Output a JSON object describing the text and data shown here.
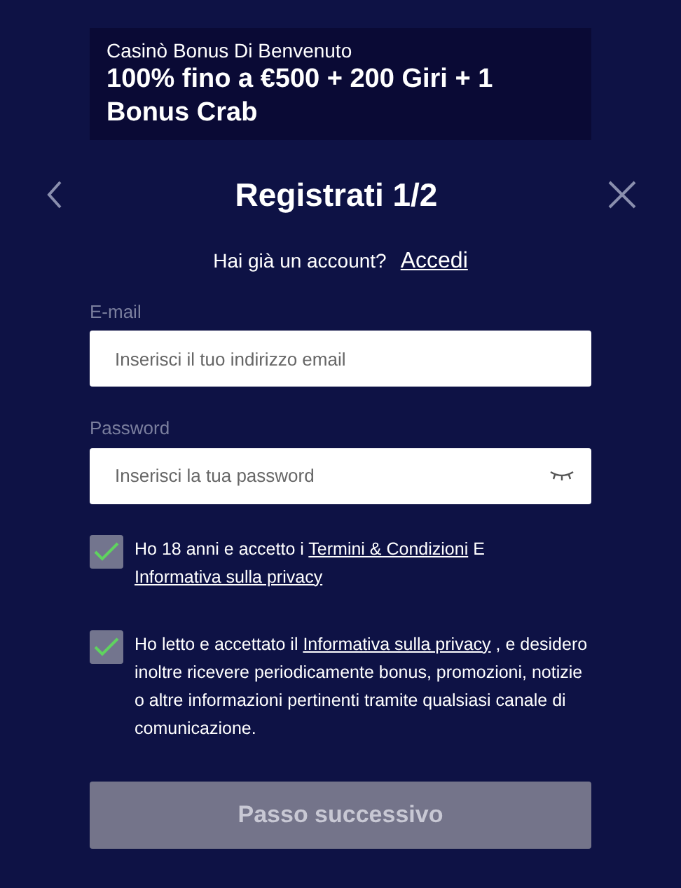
{
  "promo": {
    "subtitle": "Casinò Bonus Di Benvenuto",
    "title": "100% fino a €500 + 200 Giri + 1 Bonus Crab"
  },
  "header": {
    "title": "Registrati 1/2"
  },
  "login_prompt": {
    "text": "Hai già un account?",
    "link": "Accedi"
  },
  "fields": [
    {
      "label": "E-mail",
      "placeholder": "Inserisci il tuo indirizzo email",
      "kind": "email"
    },
    {
      "label": "Password",
      "placeholder": "Inserisci la tua password",
      "kind": "password"
    }
  ],
  "consents": [
    {
      "checked": true,
      "parts": [
        {
          "kind": "text",
          "text": "Ho 18 anni e accetto i "
        },
        {
          "kind": "link",
          "text": "Termini & Condizioni"
        },
        {
          "kind": "text",
          "text": " E "
        },
        {
          "kind": "link",
          "text": "Informativa sulla privacy"
        }
      ]
    },
    {
      "checked": true,
      "parts": [
        {
          "kind": "text",
          "text": "Ho letto e accettato il "
        },
        {
          "kind": "link",
          "text": "Informativa sulla privacy"
        },
        {
          "kind": "text",
          "text": " , e desidero inoltre ricevere periodicamente bonus, promozioni, notizie o altre informazioni pertinenti tramite qualsiasi canale di comunicazione."
        }
      ]
    }
  ],
  "next_button": {
    "label": "Passo successivo",
    "disabled": true
  }
}
